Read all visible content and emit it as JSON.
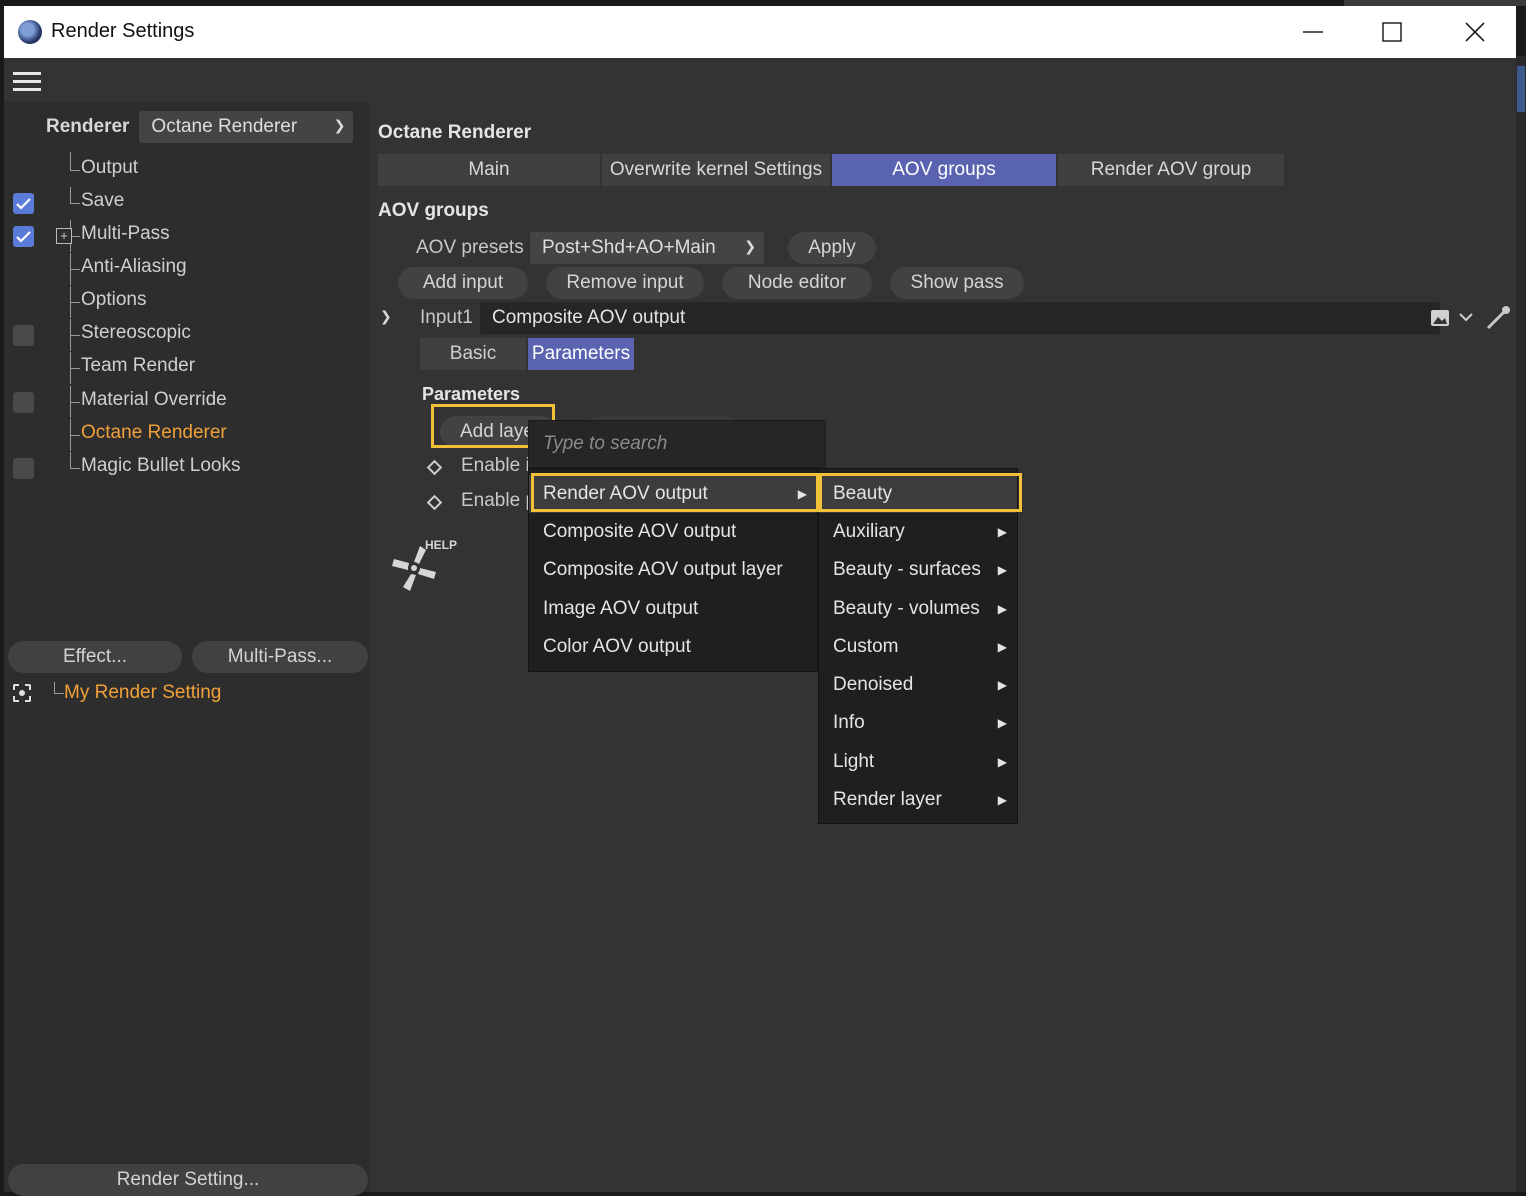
{
  "window": {
    "title": "Render Settings"
  },
  "sidebar": {
    "renderer_label": "Renderer",
    "renderer_value": "Octane Renderer",
    "items": [
      {
        "label": "Output",
        "checkbox": "none"
      },
      {
        "label": "Save",
        "checkbox": "on"
      },
      {
        "label": "Multi-Pass",
        "checkbox": "on",
        "expandable": true
      },
      {
        "label": "Anti-Aliasing",
        "checkbox": "none"
      },
      {
        "label": "Options",
        "checkbox": "none"
      },
      {
        "label": "Stereoscopic",
        "checkbox": "off"
      },
      {
        "label": "Team Render",
        "checkbox": "none"
      },
      {
        "label": "Material Override",
        "checkbox": "off"
      },
      {
        "label": "Octane Renderer",
        "checkbox": "none",
        "active": true
      },
      {
        "label": "Magic Bullet Looks",
        "checkbox": "off"
      }
    ],
    "effect_button": "Effect...",
    "multipass_button": "Multi-Pass...",
    "render_setting_item": "My Render Setting",
    "render_setting_button": "Render Setting..."
  },
  "main": {
    "panel_title": "Octane Renderer",
    "tabs": [
      "Main",
      "Overwrite kernel Settings",
      "AOV groups",
      "Render AOV group"
    ],
    "active_tab": "AOV groups",
    "section_title": "AOV groups",
    "aov_presets_label": "AOV presets",
    "aov_presets_value": "Post+Shd+AO+Main",
    "apply_button": "Apply",
    "add_input_button": "Add input",
    "remove_input_button": "Remove input",
    "node_editor_button": "Node editor",
    "show_pass_button": "Show pass",
    "input_label": "Input1",
    "input_value": "Composite AOV output",
    "subtabs": [
      "Basic",
      "Parameters"
    ],
    "parameters_title": "Parameters",
    "add_layer_button": "Add laye",
    "enable_1": "Enable i",
    "enable_2": "Enable p",
    "help_label": "HELP"
  },
  "popup": {
    "search_placeholder": "Type to search",
    "menu": [
      "Render AOV output",
      "Composite AOV output",
      "Composite AOV output layer",
      "Image AOV output",
      "Color AOV output"
    ],
    "submenu": [
      "Beauty",
      "Auxiliary",
      "Beauty - surfaces",
      "Beauty - volumes",
      "Custom",
      "Denoised",
      "Info",
      "Light",
      "Render layer"
    ]
  },
  "colors": {
    "accent": "#5a63b0",
    "active_item": "#f0a03a",
    "highlight": "#f2c13a",
    "checkbox_on": "#5b7bd8"
  }
}
